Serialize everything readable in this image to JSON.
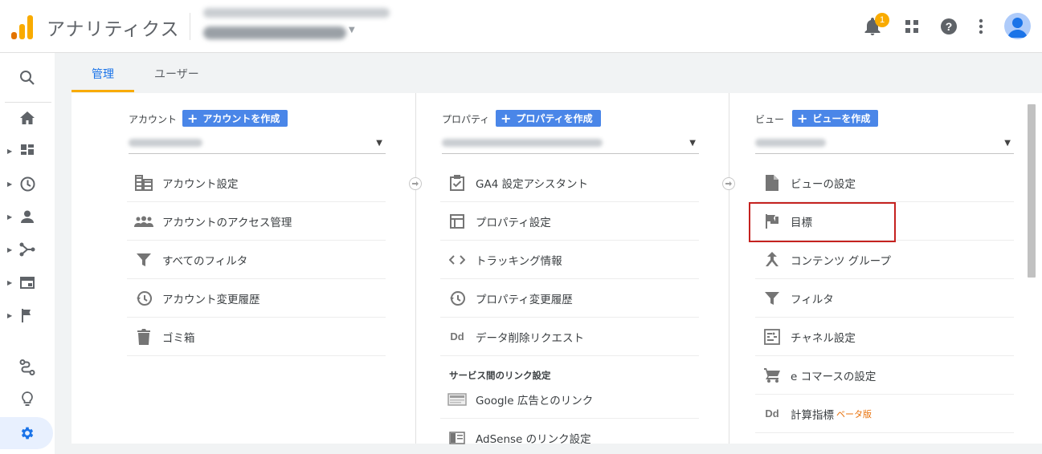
{
  "header": {
    "app_title": "アナリティクス",
    "notification_count": "1"
  },
  "tabs": [
    {
      "label": "管理",
      "active": true
    },
    {
      "label": "ユーザー",
      "active": false
    }
  ],
  "columns": {
    "account": {
      "label": "アカウント",
      "create_label": "アカウントを作成",
      "items": [
        {
          "label": "アカウント設定",
          "icon": "building-icon"
        },
        {
          "label": "アカウントのアクセス管理",
          "icon": "people-icon"
        },
        {
          "label": "すべてのフィルタ",
          "icon": "filter-icon"
        },
        {
          "label": "アカウント変更履歴",
          "icon": "history-icon"
        },
        {
          "label": "ゴミ箱",
          "icon": "trash-icon"
        }
      ]
    },
    "property": {
      "label": "プロパティ",
      "create_label": "プロパティを作成",
      "items": [
        {
          "label": "GA4 設定アシスタント",
          "icon": "clipboard-check-icon"
        },
        {
          "label": "プロパティ設定",
          "icon": "window-icon"
        },
        {
          "label": "トラッキング情報",
          "icon": "code-icon"
        },
        {
          "label": "プロパティ変更履歴",
          "icon": "history-icon"
        },
        {
          "label": "データ削除リクエスト",
          "icon": "dd-icon",
          "icon_text": "Dd"
        }
      ],
      "links_section": {
        "title": "サービス間のリンク設定",
        "items": [
          {
            "label": "Google 広告とのリンク",
            "icon": "ads-panel-icon"
          },
          {
            "label": "AdSense のリンク設定",
            "icon": "adsense-panel-icon"
          }
        ]
      }
    },
    "view": {
      "label": "ビュー",
      "create_label": "ビューを作成",
      "items": [
        {
          "label": "ビューの設定",
          "icon": "document-icon"
        },
        {
          "label": "目標",
          "icon": "flag-icon",
          "highlighted": true
        },
        {
          "label": "コンテンツ グループ",
          "icon": "content-group-icon"
        },
        {
          "label": "フィルタ",
          "icon": "filter-icon"
        },
        {
          "label": "チャネル設定",
          "icon": "channel-icon"
        },
        {
          "label": "e コマースの設定",
          "icon": "cart-icon"
        },
        {
          "label": "計算指標",
          "icon": "dd-icon",
          "icon_text": "Dd",
          "beta": "ベータ版"
        }
      ]
    }
  },
  "colors": {
    "accent_blue": "#1a73e8",
    "button_blue": "#4a86e8",
    "tab_underline": "#f9ab00",
    "highlight_red": "#c5221f"
  }
}
